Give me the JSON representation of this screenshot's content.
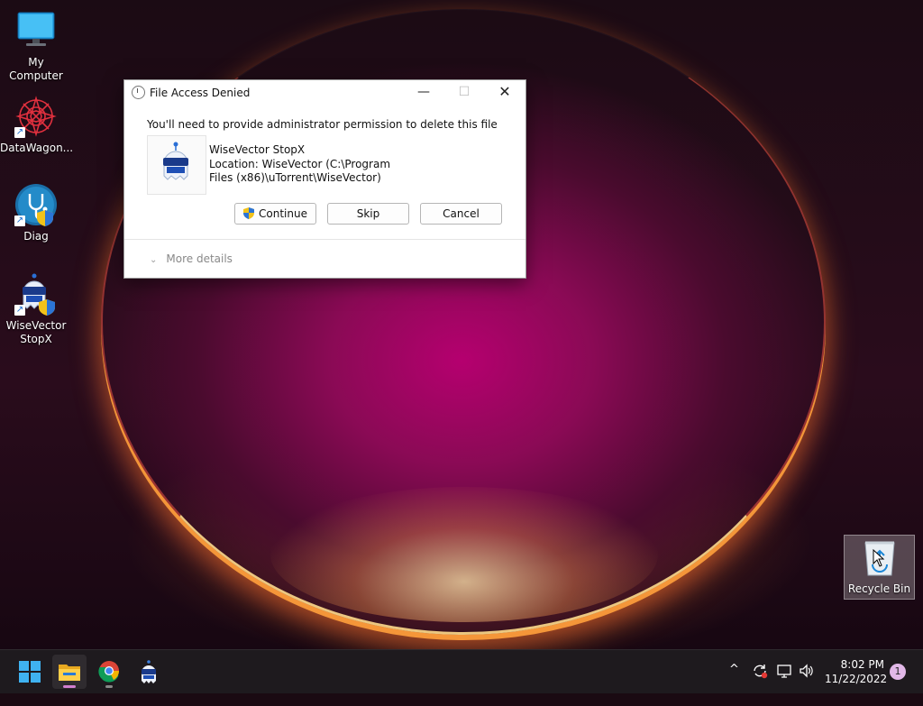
{
  "desktop": {
    "icons": [
      {
        "label": "My Computer"
      },
      {
        "label": "DataWagon..."
      },
      {
        "label": "Diag"
      },
      {
        "label": "WiseVector StopX"
      }
    ],
    "recycle_bin": {
      "label": "Recycle Bin"
    }
  },
  "dialog": {
    "title": "File Access Denied",
    "message": "You'll need to provide administrator permission to delete this file",
    "app_name": "WiseVector StopX",
    "location": "Location: WiseVector (C:\\Program Files (x86)\\uTorrent\\WiseVector)",
    "buttons": {
      "continue": "Continue",
      "skip": "Skip",
      "cancel": "Cancel"
    },
    "more_details": "More details",
    "controls": {
      "minimize": "—",
      "maximize": "☐",
      "close": "✕"
    }
  },
  "taskbar": {
    "apps": [
      {
        "icon": "windows-start-icon"
      },
      {
        "icon": "file-explorer-icon"
      },
      {
        "icon": "chrome-icon"
      },
      {
        "icon": "wisevector-icon"
      }
    ],
    "tray_chevron": "^",
    "clock": {
      "time": "8:02 PM",
      "date": "11/22/2022"
    },
    "notifications": "1"
  },
  "colors": {
    "accent": "#0067c0",
    "dialog_bg": "#ffffff",
    "taskbar_bg": "#1e1a1e"
  }
}
